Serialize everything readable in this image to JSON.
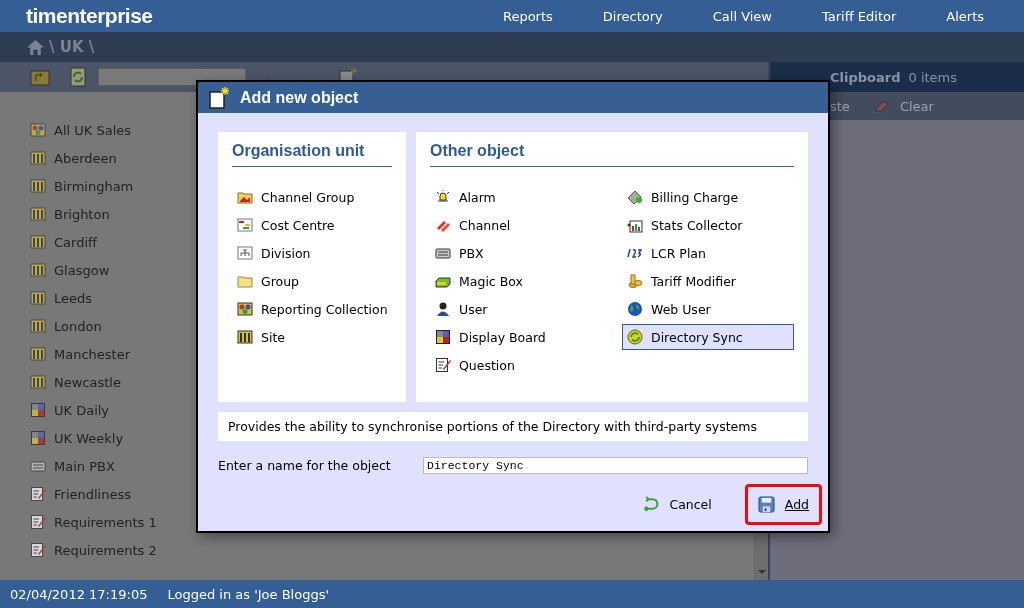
{
  "app": {
    "logo": "timenterprise"
  },
  "nav": [
    {
      "label": "Reports"
    },
    {
      "label": "Directory"
    },
    {
      "label": "Call View"
    },
    {
      "label": "Tariff Editor"
    },
    {
      "label": "Alerts"
    }
  ],
  "breadcrumb": {
    "path": "\\ UK \\"
  },
  "tree": [
    {
      "label": "All UK Sales",
      "kind": "collection"
    },
    {
      "label": "Aberdeen",
      "kind": "site"
    },
    {
      "label": "Birmingham",
      "kind": "site"
    },
    {
      "label": "Brighton",
      "kind": "site"
    },
    {
      "label": "Cardiff",
      "kind": "site"
    },
    {
      "label": "Glasgow",
      "kind": "site"
    },
    {
      "label": "Leeds",
      "kind": "site"
    },
    {
      "label": "London",
      "kind": "site"
    },
    {
      "label": "Manchester",
      "kind": "site"
    },
    {
      "label": "Newcastle",
      "kind": "site"
    },
    {
      "label": "UK Daily",
      "kind": "board"
    },
    {
      "label": "UK Weekly",
      "kind": "board"
    },
    {
      "label": "Main PBX",
      "kind": "pbx"
    },
    {
      "label": "Friendliness",
      "kind": "question"
    },
    {
      "label": "Requirements 1",
      "kind": "question"
    },
    {
      "label": "Requirements 2",
      "kind": "question"
    }
  ],
  "clipboard": {
    "title": "Clipboard",
    "count": "0 items",
    "paste": "ste",
    "clear": "Clear"
  },
  "dialog": {
    "title": "Add new object",
    "org": {
      "heading": "Organisation unit",
      "items": [
        {
          "label": "Channel Group",
          "kind": "channelgroup",
          "selected": false
        },
        {
          "label": "Cost Centre",
          "kind": "costcentre",
          "selected": false
        },
        {
          "label": "Division",
          "kind": "division",
          "selected": false
        },
        {
          "label": "Group",
          "kind": "group",
          "selected": false
        },
        {
          "label": "Reporting Collection",
          "kind": "collection",
          "selected": false
        },
        {
          "label": "Site",
          "kind": "site",
          "selected": false
        }
      ]
    },
    "other": {
      "heading": "Other object",
      "items": [
        {
          "label": "Alarm",
          "kind": "alarm",
          "selected": false
        },
        {
          "label": "Channel",
          "kind": "channel",
          "selected": false
        },
        {
          "label": "PBX",
          "kind": "pbx",
          "selected": false
        },
        {
          "label": "Magic Box",
          "kind": "magicbox",
          "selected": false
        },
        {
          "label": "User",
          "kind": "user",
          "selected": false
        },
        {
          "label": "Display Board",
          "kind": "board",
          "selected": false
        },
        {
          "label": "Question",
          "kind": "question",
          "selected": false
        },
        {
          "label": "Billing Charge",
          "kind": "billing",
          "selected": false
        },
        {
          "label": "Stats Collector",
          "kind": "stats",
          "selected": false
        },
        {
          "label": "LCR Plan",
          "kind": "lcr",
          "selected": false
        },
        {
          "label": "Tariff Modifier",
          "kind": "tariff",
          "selected": false
        },
        {
          "label": "Web User",
          "kind": "webuser",
          "selected": false
        },
        {
          "label": "Directory Sync",
          "kind": "sync",
          "selected": true
        }
      ]
    },
    "description": "Provides the ability to synchronise portions of the Directory with third-party systems",
    "name_label": "Enter a name for the object",
    "name_value": "Directory Sync",
    "cancel": "Cancel",
    "add": "Add",
    "add_highlighted": true
  },
  "status_bar": {
    "datetime": "02/04/2012 17:19:05",
    "user": "Logged in as 'Joe Bloggs'"
  }
}
